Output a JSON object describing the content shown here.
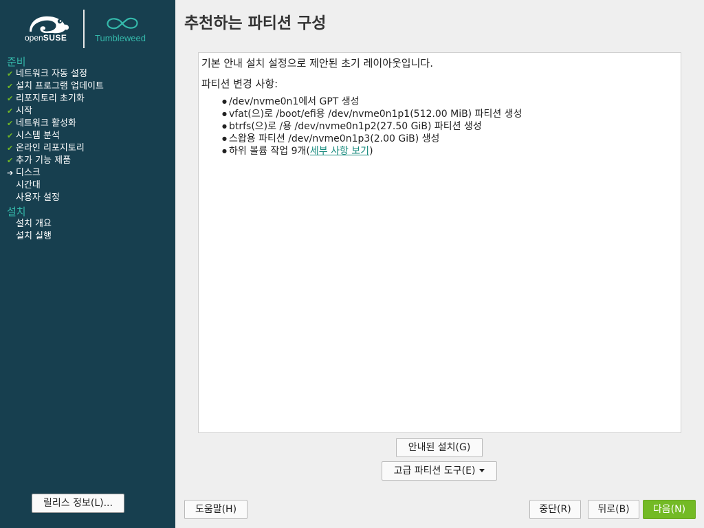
{
  "logo": {
    "opensuse_prefix": "open",
    "opensuse_suffix": "SUSE",
    "product": "Tumbleweed"
  },
  "colors": {
    "sidebar_bg": "#173f4f",
    "accent": "#35b9ab",
    "check": "#73ba25",
    "next_button": "#73ba25",
    "link": "#178a7d"
  },
  "sidebar": {
    "sections": [
      {
        "title": "준비",
        "steps": [
          {
            "label": "네트워크 자동 설정",
            "status": "done",
            "icon": "check-icon"
          },
          {
            "label": "설치 프로그램 업데이트",
            "status": "done",
            "icon": "check-icon"
          },
          {
            "label": "리포지토리 초기화",
            "status": "done",
            "icon": "check-icon"
          },
          {
            "label": "시작",
            "status": "done",
            "icon": "check-icon"
          },
          {
            "label": "네트워크 활성화",
            "status": "done",
            "icon": "check-icon"
          },
          {
            "label": "시스템 분석",
            "status": "done",
            "icon": "check-icon"
          },
          {
            "label": "온라인 리포지토리",
            "status": "done",
            "icon": "check-icon"
          },
          {
            "label": "추가 기능 제품",
            "status": "done",
            "icon": "check-icon"
          },
          {
            "label": "디스크",
            "status": "current",
            "icon": "arrow-right-icon"
          },
          {
            "label": "시간대",
            "status": "pending",
            "icon": ""
          },
          {
            "label": "사용자 설정",
            "status": "pending",
            "icon": ""
          }
        ]
      },
      {
        "title": "설치",
        "steps": [
          {
            "label": "설치 개요",
            "status": "pending",
            "icon": ""
          },
          {
            "label": "설치 실행",
            "status": "pending",
            "icon": ""
          }
        ]
      }
    ],
    "release_notes_button": "릴리스 정보(L)..."
  },
  "main": {
    "title": "추천하는 파티션 구성",
    "intro": "기본 안내 설치 설정으로 제안된 초기 레이아웃입니다.",
    "changes_header": "파티션 변경 사항:",
    "changes": [
      "/dev/nvme0n1에서 GPT 생성",
      "vfat(으)로 /boot/efi용 /dev/nvme0n1p1(512.00 MiB) 파티션 생성",
      "btrfs(으)로 /용 /dev/nvme0n1p2(27.50 GiB) 파티션 생성",
      "스왑용 파티션 /dev/nvme0n1p3(2.00 GiB) 생성"
    ],
    "subvolume_text": "하위 볼륨 작업 9개(",
    "subvolume_link": "세부 사항 보기",
    "subvolume_close": ")",
    "guided_button": "안내된 설치(G)",
    "expert_button": "고급 파티션 도구(E)"
  },
  "footer": {
    "help_button": "도움말(H)",
    "abort_button": "중단(R)",
    "back_button": "뒤로(B)",
    "next_button": "다음(N)"
  }
}
